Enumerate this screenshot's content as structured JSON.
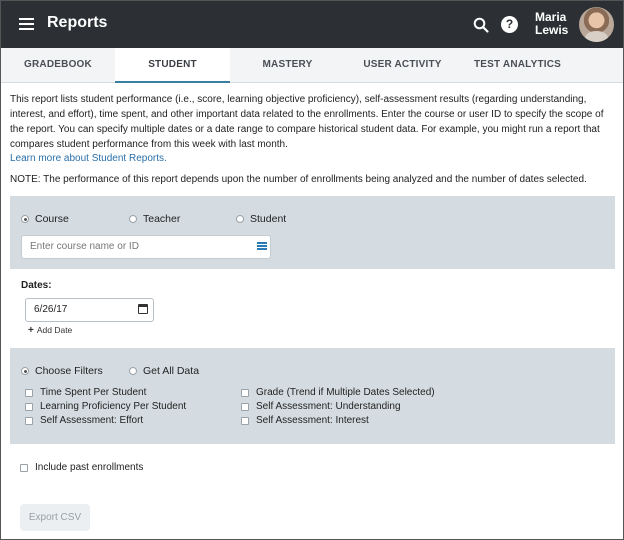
{
  "header": {
    "title": "Reports",
    "help_glyph": "?",
    "user_first": "Maria",
    "user_last": "Lewis"
  },
  "tabs": [
    {
      "label": "GRADEBOOK",
      "active": false
    },
    {
      "label": "STUDENT",
      "active": true
    },
    {
      "label": "MASTERY",
      "active": false
    },
    {
      "label": "USER ACTIVITY",
      "active": false
    },
    {
      "label": "TEST ANALYTICS",
      "active": false
    }
  ],
  "intro": "This report lists student performance (i.e., score, learning objective proficiency), self-assessment results (regarding understanding, interest, and effort), time spent, and other important data related to the enrollments. Enter the course or user ID to specify the scope of the report. You can specify multiple dates or a date range to compare historical student data. For example, you might run a report that compares student performance from this week with last month.",
  "learn_more": "Learn more about Student Reports.",
  "note": "NOTE: The performance of this report depends upon the number of enrollments being analyzed and the number of dates selected.",
  "scope": {
    "options": [
      "Course",
      "Teacher",
      "Student"
    ],
    "selected": "Course",
    "input_placeholder": "Enter course name or ID"
  },
  "dates": {
    "label": "Dates:",
    "value": "6/26/17",
    "add_label": "Add Date"
  },
  "filters": {
    "mode_options": [
      "Choose Filters",
      "Get All Data"
    ],
    "selected": "Choose Filters",
    "left": [
      "Time Spent Per Student",
      "Learning Proficiency Per Student",
      "Self Assessment: Effort"
    ],
    "right": [
      "Grade (Trend if Multiple Dates Selected)",
      "Self Assessment: Understanding",
      "Self Assessment: Interest"
    ]
  },
  "include_past": "Include past enrollments",
  "export_label": "Export CSV",
  "colors": {
    "header_bg": "#2c3035",
    "tab_accent": "#3a7fa1",
    "link": "#2a6fa8",
    "panel_bg": "#d4dce1"
  }
}
